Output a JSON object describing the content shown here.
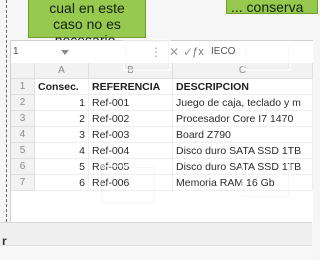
{
  "callouts": {
    "left_lines": [
      "cual en este",
      "caso no es",
      "necesario,"
    ],
    "right_text": "... conserva"
  },
  "formula_bar": {
    "namebox": "1",
    "formula_snippet": "IECO"
  },
  "columns": [
    "A",
    "B",
    "C"
  ],
  "rows": [
    "1",
    "2",
    "3",
    "4",
    "5",
    "6",
    "7"
  ],
  "table": {
    "headers": {
      "a": "Consec.",
      "b": "REFERENCIA",
      "c": "DESCRIPCION"
    },
    "data": [
      {
        "a": "1",
        "b": "Ref-001",
        "c": "Juego de caja, teclado y m"
      },
      {
        "a": "2",
        "b": "Ref-002",
        "c": "Procesador Core I7 1470"
      },
      {
        "a": "3",
        "b": "Ref-003",
        "c": "Board Z790"
      },
      {
        "a": "4",
        "b": "Ref-004",
        "c": "Disco duro SATA SSD 1TB"
      },
      {
        "a": "5",
        "b": "Ref-005",
        "c": "Disco duro SATA SSD 1TB"
      },
      {
        "a": "6",
        "b": "Ref-006",
        "c": "Memoria RAM 16 Gb"
      }
    ]
  },
  "bottom": {
    "label": "r"
  }
}
